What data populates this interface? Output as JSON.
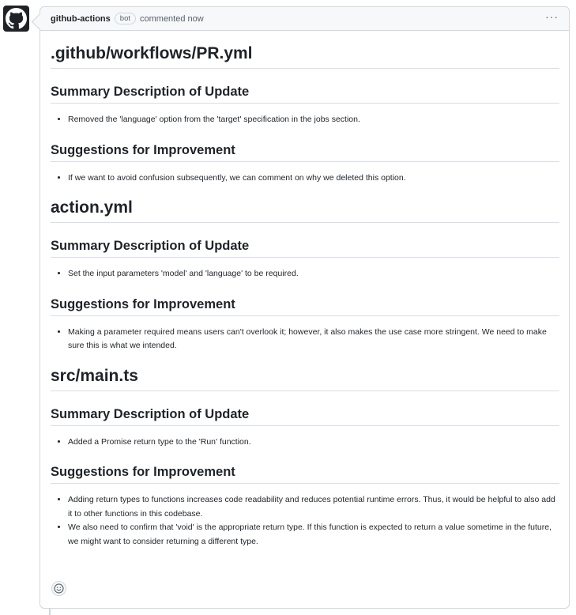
{
  "comment": {
    "author": "github-actions",
    "badge": "bot",
    "action": "commented now",
    "menu_icon": "kebab-horizontal-icon",
    "avatar_icon": "github-mark-icon",
    "reaction_icon": "smiley-icon"
  },
  "files": [
    {
      "title": ".github/workflows/PR.yml",
      "summary_heading": "Summary Description of Update",
      "summary_items": [
        "Removed the 'language' option from the 'target' specification in the jobs section."
      ],
      "suggestions_heading": "Suggestions for Improvement",
      "suggestions_items": [
        "If we want to avoid confusion subsequently, we can comment on why we deleted this option."
      ]
    },
    {
      "title": "action.yml",
      "summary_heading": "Summary Description of Update",
      "summary_items": [
        "Set the input parameters 'model' and 'language' to be required."
      ],
      "suggestions_heading": "Suggestions for Improvement",
      "suggestions_items": [
        "Making a parameter required means users can't overlook it; however, it also makes the use case more stringent. We need to make sure this is what we intended."
      ]
    },
    {
      "title": "src/main.ts",
      "summary_heading": "Summary Description of Update",
      "summary_items": [
        "Added a Promise return type to the 'Run' function."
      ],
      "suggestions_heading": "Suggestions for Improvement",
      "suggestions_items": [
        "Adding return types to functions increases code readability and reduces potential runtime errors. Thus, it would be helpful to also add it to other functions in this codebase.",
        "We also need to confirm that 'void' is the appropriate return type. If this function is expected to return a value sometime in the future, we might want to consider returning a different type."
      ]
    }
  ]
}
